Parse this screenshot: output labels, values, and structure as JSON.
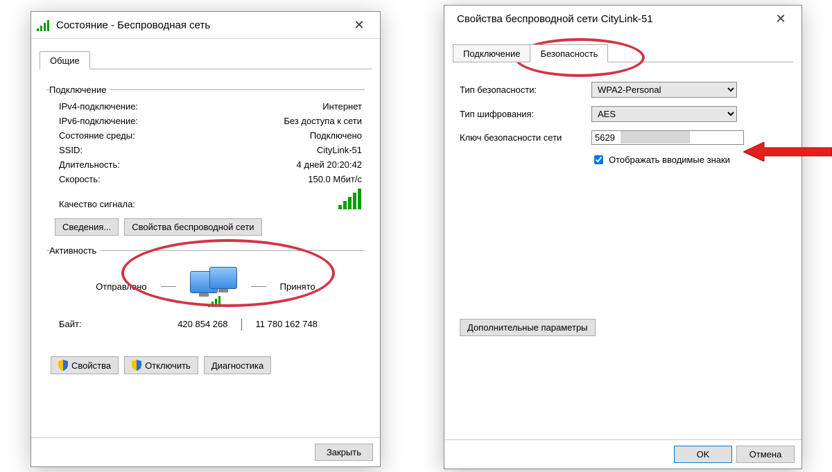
{
  "status_window": {
    "title": "Состояние - Беспроводная сеть",
    "tab_general": "Общие",
    "group_connection": "Подключение",
    "rows": {
      "ipv4_lbl": "IPv4-подключение:",
      "ipv4_val": "Интернет",
      "ipv6_lbl": "IPv6-подключение:",
      "ipv6_val": "Без доступа к сети",
      "media_lbl": "Состояние среды:",
      "media_val": "Подключено",
      "ssid_lbl": "SSID:",
      "ssid_val": "CityLink-51",
      "dur_lbl": "Длительность:",
      "dur_val": "4 дней 20:20:42",
      "spd_lbl": "Скорость:",
      "spd_val": "150.0 Мбит/с",
      "quality_lbl": "Качество сигнала:"
    },
    "btn_details": "Сведения...",
    "btn_wprops": "Свойства беспроводной сети",
    "group_activity": "Активность",
    "activity": {
      "sent_lbl": "Отправлено",
      "recv_lbl": "Принято",
      "bytes_lbl": "Байт:",
      "sent_val": "420 854 268",
      "recv_val": "11 780 162 748"
    },
    "btn_props": "Свойства",
    "btn_disable": "Отключить",
    "btn_diag": "Диагностика",
    "btn_close": "Закрыть"
  },
  "props_window": {
    "title": "Свойства беспроводной сети CityLink-51",
    "tab_connection": "Подключение",
    "tab_security": "Безопасность",
    "sec_type_lbl": "Тип безопасности:",
    "sec_type_val": "WPA2-Personal",
    "enc_lbl": "Тип шифрования:",
    "enc_val": "AES",
    "key_lbl": "Ключ безопасности сети",
    "key_val": "5629",
    "show_chars": "Отображать вводимые знаки",
    "btn_advanced": "Дополнительные параметры",
    "btn_ok": "OK",
    "btn_cancel": "Отмена"
  }
}
